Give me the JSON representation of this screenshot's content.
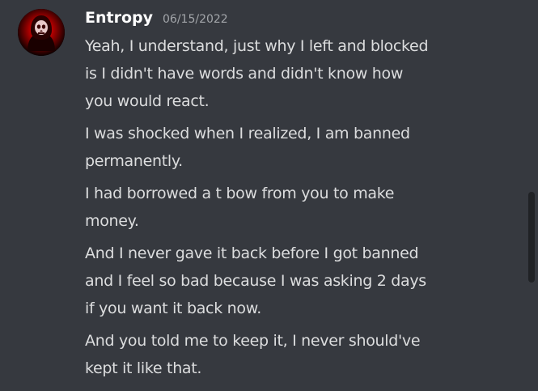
{
  "author": {
    "username": "Entropy",
    "timestamp": "06/15/2022",
    "avatar_icon": "red-skull-avatar-icon"
  },
  "messages": [
    {
      "lines": [
        "Yeah, I understand, just why I left and blocked",
        "is I didn't have words and didn't know how",
        "you would react."
      ]
    },
    {
      "lines": [
        "I was shocked when I realized, I am banned",
        "permanently."
      ]
    },
    {
      "lines": [
        "I had borrowed a t bow from you to make",
        "money."
      ]
    },
    {
      "lines": [
        "And I never gave it back before I got banned",
        "and I feel so bad because I was asking 2 days",
        "if you want it back now."
      ]
    },
    {
      "lines": [
        "And you told me to keep it, I never should've",
        "kept it like that."
      ]
    }
  ],
  "colors": {
    "background": "#36393f",
    "message_text": "#dcddde",
    "username": "#ffffff",
    "timestamp": "#a3a6aa",
    "scrollbar_thumb": "#202225"
  }
}
